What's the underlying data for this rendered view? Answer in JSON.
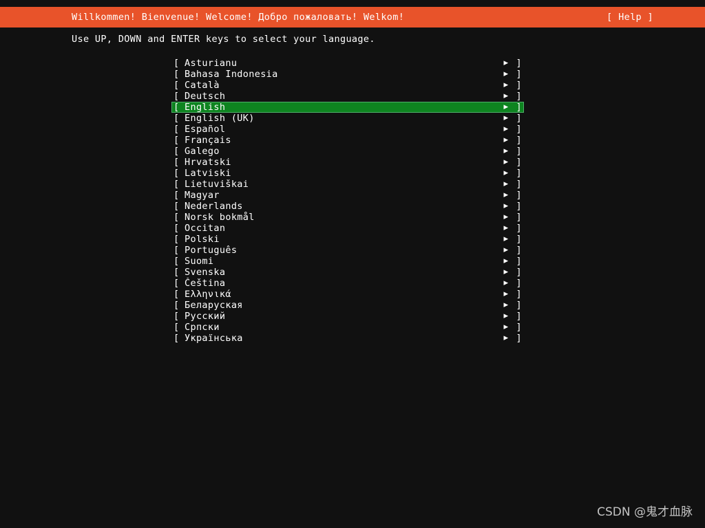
{
  "colors": {
    "background": "#111111",
    "header_bar": "#e8532a",
    "selection_green": "#0e8420",
    "selection_border": "#4fb06a",
    "text": "#ffffff",
    "watermark_text": "#d3d3d3"
  },
  "header": {
    "welcome": "Willkommen! Bienvenue! Welcome! Добро пожаловать! Welkom!",
    "help_label": "[ Help ]"
  },
  "instruction": "Use UP, DOWN and ENTER keys to select your language.",
  "list": {
    "bracket_open": "[",
    "bracket_close": "]",
    "arrow_icon": "▶",
    "selected_index": 4,
    "items": [
      {
        "label": "Asturianu"
      },
      {
        "label": "Bahasa Indonesia"
      },
      {
        "label": "Català"
      },
      {
        "label": "Deutsch"
      },
      {
        "label": "English"
      },
      {
        "label": "English (UK)"
      },
      {
        "label": "Español"
      },
      {
        "label": "Français"
      },
      {
        "label": "Galego"
      },
      {
        "label": "Hrvatski"
      },
      {
        "label": "Latviski"
      },
      {
        "label": "Lietuviškai"
      },
      {
        "label": "Magyar"
      },
      {
        "label": "Nederlands"
      },
      {
        "label": "Norsk bokmål"
      },
      {
        "label": "Occitan"
      },
      {
        "label": "Polski"
      },
      {
        "label": "Português"
      },
      {
        "label": "Suomi"
      },
      {
        "label": "Svenska"
      },
      {
        "label": "Čeština"
      },
      {
        "label": "Ελληνικά"
      },
      {
        "label": "Беларуская"
      },
      {
        "label": "Русский"
      },
      {
        "label": "Српски"
      },
      {
        "label": "Українська"
      }
    ]
  },
  "watermark": "CSDN @鬼才血脉"
}
